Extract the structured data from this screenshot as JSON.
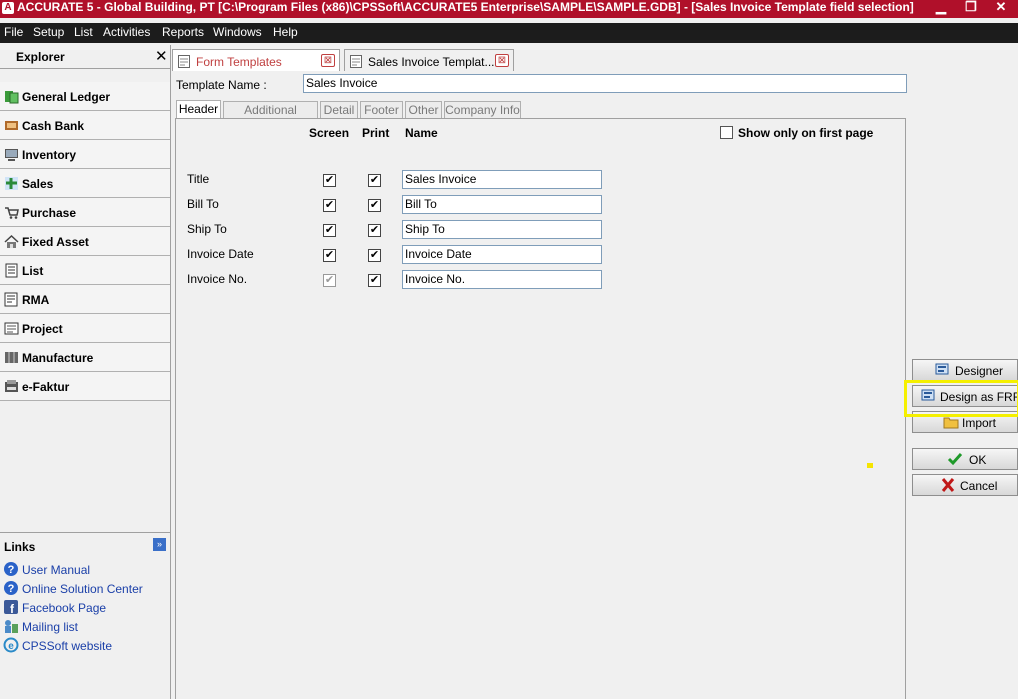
{
  "window": {
    "title": "ACCURATE 5  - Global Building, PT   [C:\\Program Files (x86)\\CPSSoft\\ACCURATE5 Enterprise\\SAMPLE\\SAMPLE.GDB] - [Sales Invoice Template field selection]",
    "minimize": "▁",
    "restore": "❐",
    "close": "✕"
  },
  "menu": {
    "file": "File",
    "setup": "Setup",
    "list": "List",
    "activities": "Activities",
    "reports": "Reports",
    "windows": "Windows",
    "help": "Help"
  },
  "explorer": {
    "title": "Explorer",
    "close": "✕",
    "items": [
      {
        "label": "General Ledger",
        "icon": "general-ledger-icon"
      },
      {
        "label": "Cash Bank",
        "icon": "cash-bank-icon"
      },
      {
        "label": "Inventory",
        "icon": "inventory-icon"
      },
      {
        "label": "Sales",
        "icon": "sales-icon"
      },
      {
        "label": "Purchase",
        "icon": "purchase-cart-icon"
      },
      {
        "label": "Fixed Asset",
        "icon": "fixed-asset-house-icon"
      },
      {
        "label": "List",
        "icon": "list-icon"
      },
      {
        "label": "RMA",
        "icon": "rma-icon"
      },
      {
        "label": "Project",
        "icon": "project-icon"
      },
      {
        "label": "Manufacture",
        "icon": "manufacture-icon"
      },
      {
        "label": "e-Faktur",
        "icon": "efaktur-icon"
      }
    ]
  },
  "links": {
    "title": "Links",
    "toggle": "»",
    "items": [
      {
        "label": "User Manual",
        "icon": "help-icon"
      },
      {
        "label": "Online Solution Center",
        "icon": "help-icon"
      },
      {
        "label": "Facebook Page",
        "icon": "facebook-icon"
      },
      {
        "label": "Mailing list",
        "icon": "mailing-list-icon"
      },
      {
        "label": "CPSSoft website",
        "icon": "web-icon"
      }
    ]
  },
  "tabs": [
    {
      "label": "Form Templates",
      "close": "⊠"
    },
    {
      "label": "Sales Invoice Templat...",
      "close": "⊠"
    }
  ],
  "template": {
    "name_label": "Template Name :",
    "name_value": "Sales Invoice"
  },
  "subtabs": [
    "Header",
    "Additional Header",
    "Detail",
    "Footer",
    "Other",
    "Company Info"
  ],
  "columns": {
    "screen": "Screen",
    "print": "Print",
    "name": "Name"
  },
  "show_first_page": {
    "label": "Show only on first page",
    "checked": false
  },
  "fields": [
    {
      "label": "Title",
      "screen": true,
      "screen_disabled": false,
      "print": true,
      "name": "Sales Invoice"
    },
    {
      "label": "Bill To",
      "screen": true,
      "screen_disabled": false,
      "print": true,
      "name": "Bill To"
    },
    {
      "label": "Ship To",
      "screen": true,
      "screen_disabled": false,
      "print": true,
      "name": "Ship To"
    },
    {
      "label": "Invoice Date",
      "screen": true,
      "screen_disabled": false,
      "print": true,
      "name": "Invoice Date"
    },
    {
      "label": "Invoice No.",
      "screen": true,
      "screen_disabled": true,
      "print": true,
      "name": "Invoice No."
    }
  ],
  "buttons": {
    "designer": "Designer",
    "design_frf": "Design as FRF",
    "import": "Import",
    "ok": "OK",
    "cancel": "Cancel"
  },
  "colors": {
    "titlebar": "#b0102a",
    "menubar": "#1c1c1c",
    "highlight": "#f5f000",
    "link": "#1a3fa8"
  }
}
